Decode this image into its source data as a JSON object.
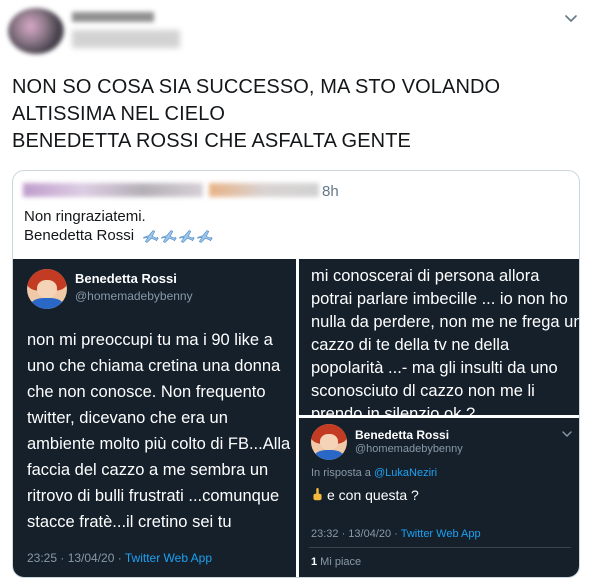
{
  "tweet": {
    "text_lines": [
      "NON SO COSA SIA SUCCESSO, MA STO VOLANDO",
      "ALTISSIMA NEL CIELO",
      "BENEDETTA ROSSI CHE ASFALTA GENTE"
    ]
  },
  "quote": {
    "time": "8h",
    "text_line1": "Non ringraziatemi.",
    "text_line2": "Benedetta Rossi",
    "emoji_icon": "airplane-icon",
    "emoji_count": 4
  },
  "screenshot_left": {
    "name": "Benedetta Rossi",
    "handle": "@homemadebybenny",
    "body_lines": [
      "non mi preoccupi tu ma i 90 like a",
      "uno che chiama cretina una donna",
      "che non conosce. Non frequento",
      "twitter, dicevano che era un",
      "ambiente molto più colto di FB...Alla",
      "faccia del cazzo a me sembra un",
      "ritrovo di bulli frustrati ...comunque",
      "stacce fratè...il cretino sei tu"
    ],
    "timestamp": "23:25 · 13/04/20 · ",
    "source": "Twitter Web App"
  },
  "screenshot_right_top": {
    "body_lines": [
      "mi conoscerai di persona allora",
      "potrai parlare imbecille ... io non ho",
      "nulla da perdere, non me ne frega un",
      "cazzo di te della tv ne della",
      "popolarità ...- ma gli insulti da uno",
      "sconosciuto dl cazzo non me li",
      "prendo in silenzio ok ?"
    ]
  },
  "screenshot_right_bottom": {
    "name": "Benedetta Rossi",
    "handle": "@homemadebybenny",
    "reply_prefix": "In risposta a ",
    "reply_to": "@LukaNeziri",
    "text": "e con questa ?",
    "emoji_icon": "middle-finger-icon",
    "timestamp": "23:32 · 13/04/20 · ",
    "source": "Twitter Web App",
    "likes_count": "1",
    "likes_label": " Mi piace"
  },
  "colors": {
    "dark_bg": "#15202b",
    "link": "#1da1f2",
    "muted": "#8899a6"
  }
}
